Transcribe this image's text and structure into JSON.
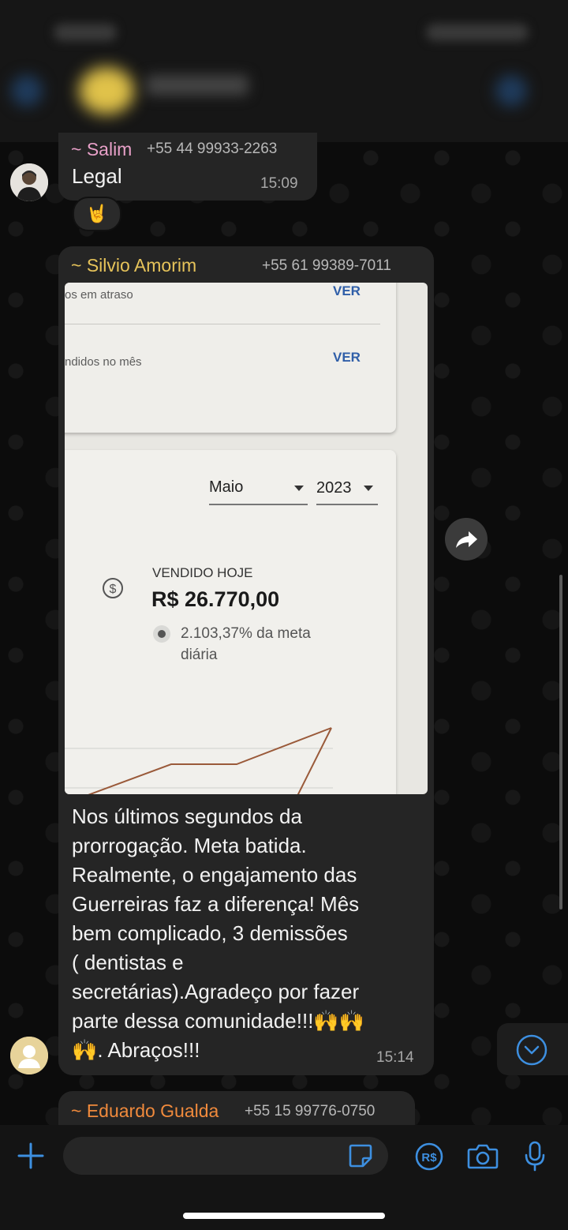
{
  "colors": {
    "accent_blue": "#3d8fe0",
    "salim_name": "#e8a0c8",
    "silvio_name": "#e6c35a",
    "eduardo_name": "#f08a3c",
    "bubble_bg": "#252525"
  },
  "messages": [
    {
      "sender": "~ Salim",
      "phone": "+55 44 99933-2263",
      "text": "Legal",
      "time": "15:09",
      "reaction": "🤘"
    },
    {
      "sender": "~ Silvio Amorim",
      "phone": "+55 61 99389-7011",
      "photo": {
        "row1_label": "os em atraso",
        "row1_link": "VER",
        "row2_label": "ndidos no mês",
        "row2_link": "VER",
        "month": "Maio",
        "year": "2023",
        "kpi_label": "VENDIDO HOJE",
        "kpi_value": "R$ 26.770,00",
        "kpi_sub_1": "2.103,37% da meta",
        "kpi_sub_2": "diária"
      },
      "text_lines": [
        "Nos últimos segundos da",
        "prorrogação. Meta batida.",
        "Realmente, o engajamento das",
        "Guerreiras faz a diferença! Mês",
        "bem complicado, 3 demissões",
        "( dentistas e",
        "secretárias).Agradeço por fazer",
        "parte dessa comunidade!!!🙌🙌",
        "🙌. Abraços!!!"
      ],
      "time": "15:14"
    },
    {
      "sender": "~ Eduardo Gualda",
      "phone": "+55 15 99776-0750"
    }
  ],
  "input": {
    "placeholder": ""
  },
  "icons": {
    "add": "plus-icon",
    "sticker": "sticker-icon",
    "payment": "pix-payment-icon",
    "camera": "camera-icon",
    "mic": "microphone-icon",
    "forward": "forward-icon",
    "scroll_down": "chevron-down-icon"
  }
}
